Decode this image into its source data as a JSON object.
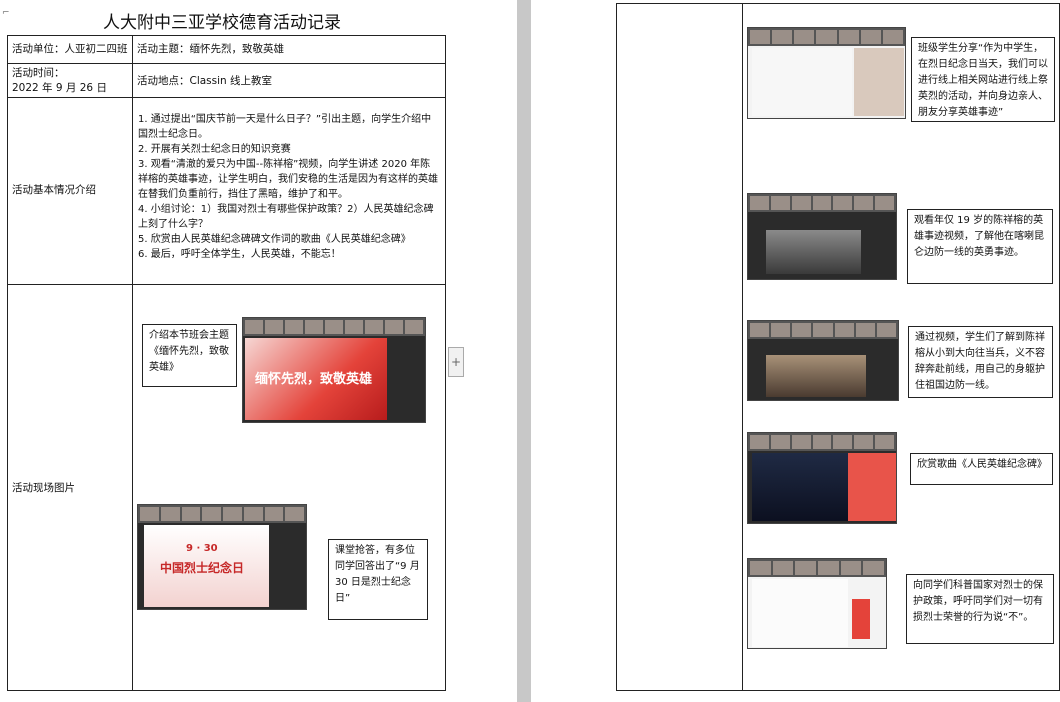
{
  "doc": {
    "title": "人大附中三亚学校德育活动记录"
  },
  "table": {
    "unit": "活动单位：人亚初二四班",
    "theme": "活动主题：缅怀先烈，致敬英雄",
    "time_label": "活动时间：",
    "time_value": "2022 年 9 月 26 日",
    "place": "活动地点：Classin 线上教室",
    "intro_label": "活动基本情况介绍",
    "intro_items": [
      "1. 通过提出“国庆节前一天是什么日子？”引出主题，向学生介绍中国烈士纪念日。",
      "2. 开展有关烈士纪念日的知识竞赛",
      "3. 观看“清澈的爱只为中国--陈祥榕”视频，向学生讲述 2020 年陈祥榕的英雄事迹，让学生明白，我们安稳的生活是因为有这样的英雄在替我们负重前行，挡住了黑暗，维护了和平。",
      "4. 小组讨论：1）我国对烈士有哪些保护政策？2）人民英雄纪念碑上刻了什么字？",
      "5. 欣赏由人民英雄纪念碑碑文作词的歌曲《人民英雄纪念碑》",
      "6. 最后，呼吁全体学生，人民英雄，不能忘！"
    ],
    "photos_label": "活动现场图片"
  },
  "left_photos": {
    "slide1_title": "缅怀先烈，致敬英雄",
    "callout1": "介绍本节班会主题《缅怀先烈，致敬英雄》",
    "slide2_title": "中国烈士纪念日",
    "slide2_date": "9 · 30",
    "callout2": "课堂抢答，有多位同学回答出了“9 月 30 日是烈士纪念日”"
  },
  "right_photos": {
    "callout1": "班级学生分享“作为中学生，在烈日纪念日当天，我们可以进行线上相关网站进行线上祭英烈的活动，并向身边亲人、朋友分享英雄事迹”",
    "callout2": "观看年仅 19 岁的陈祥榕的英雄事迹视频，了解他在喀喇昆仑边防一线的英勇事迹。",
    "callout3": "通过视频，学生们了解到陈祥榕从小到大向往当兵，义不容辞奔赴前线，用自己的身躯护住祖国边防一线。",
    "callout4": "欣赏歌曲《人民英雄纪念碑》",
    "callout5": "向同学们科普国家对烈士的保护政策，呼吁同学们对一切有损烈士荣誉的行为说“不”。"
  },
  "colors": {
    "gap": "#c8c8c8",
    "slide_red": "#e4433a"
  },
  "icons": {
    "plus_tab": "plus-icon",
    "corner": "corner-mark-icon"
  }
}
